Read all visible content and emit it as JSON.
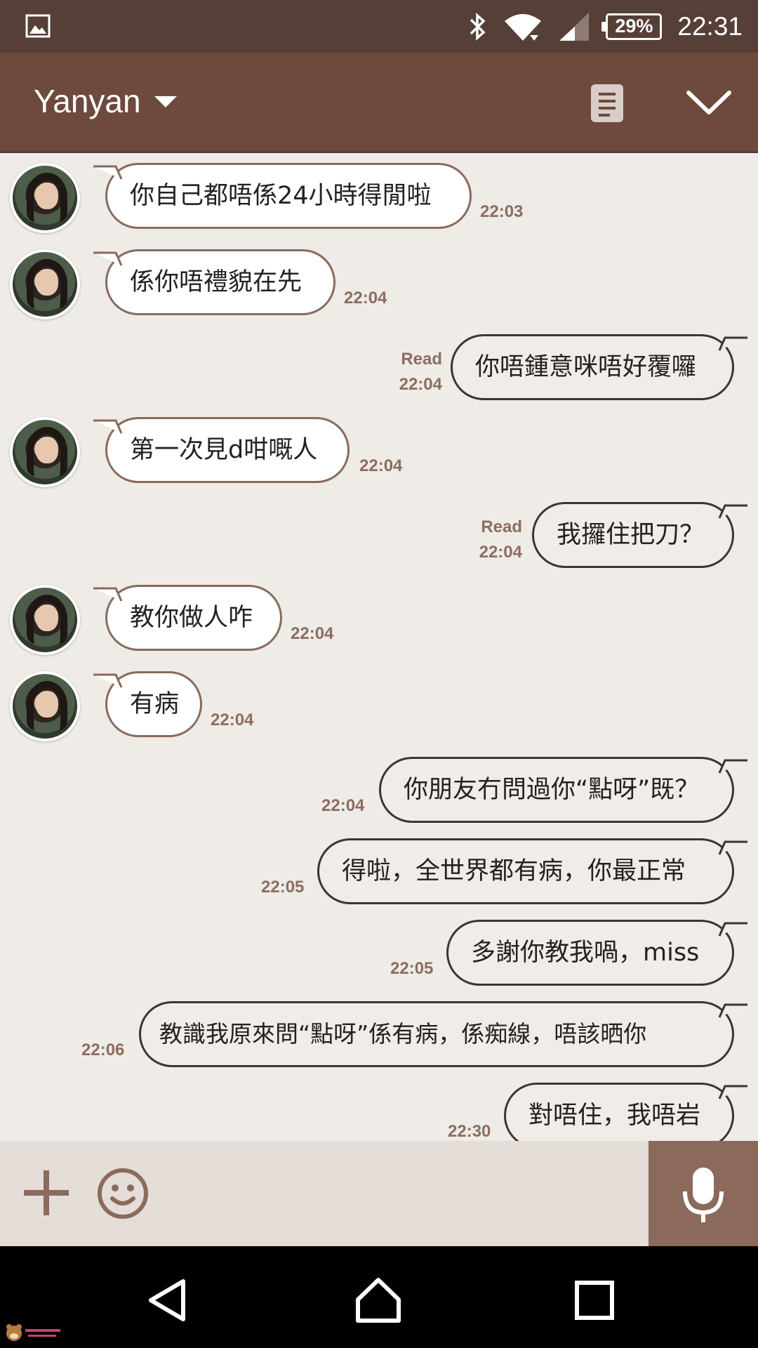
{
  "status_bar": {
    "time": "22:31",
    "battery": "29%",
    "icons": [
      "gallery-icon",
      "bluetooth-icon",
      "wifi-icon",
      "signal-icon",
      "battery-icon"
    ]
  },
  "header": {
    "title": "Yanyan",
    "icons": [
      "dropdown-caret-icon",
      "notes-icon",
      "collapse-chevron-icon"
    ]
  },
  "messages": [
    {
      "side": "in",
      "text": "你自己都唔係24小時得閒啦",
      "time": "22:03"
    },
    {
      "side": "in",
      "text": "係你唔禮貌在先",
      "time": "22:04"
    },
    {
      "side": "out",
      "text": "你唔鍾意咪唔好覆囉",
      "read": "Read",
      "time": "22:04"
    },
    {
      "side": "in",
      "text": "第一次見d咁嘅人",
      "time": "22:04"
    },
    {
      "side": "out",
      "text": "我攞住把刀？",
      "read": "Read",
      "time": "22:04"
    },
    {
      "side": "in",
      "text": "教你做人咋",
      "time": "22:04"
    },
    {
      "side": "in",
      "text": "有病",
      "time": "22:04"
    },
    {
      "side": "out",
      "text": "你朋友冇問過你“點呀”既？",
      "time": "22:04"
    },
    {
      "side": "out",
      "text": "得啦，全世界都有病，你最正常",
      "time": "22:05"
    },
    {
      "side": "out",
      "text": "多謝你教我喎，miss",
      "time": "22:05"
    },
    {
      "side": "out",
      "text": "教識我原來問“點呀”係有病，係痴線，唔該晒你",
      "time": "22:06"
    },
    {
      "side": "out",
      "text": "對唔住，我唔岩",
      "time": "22:30"
    }
  ],
  "input_bar": {
    "icons": [
      "plus-icon",
      "smiley-icon",
      "microphone-icon"
    ]
  },
  "nav_bar": {
    "icons": [
      "back-icon",
      "home-icon",
      "recent-apps-icon"
    ]
  },
  "colors": {
    "status_bar": "#553f36",
    "header": "#6d4a3d",
    "chat_bg": "#efebe7",
    "timestamp": "#8b6e60",
    "mic_button": "#8b6a5c"
  }
}
